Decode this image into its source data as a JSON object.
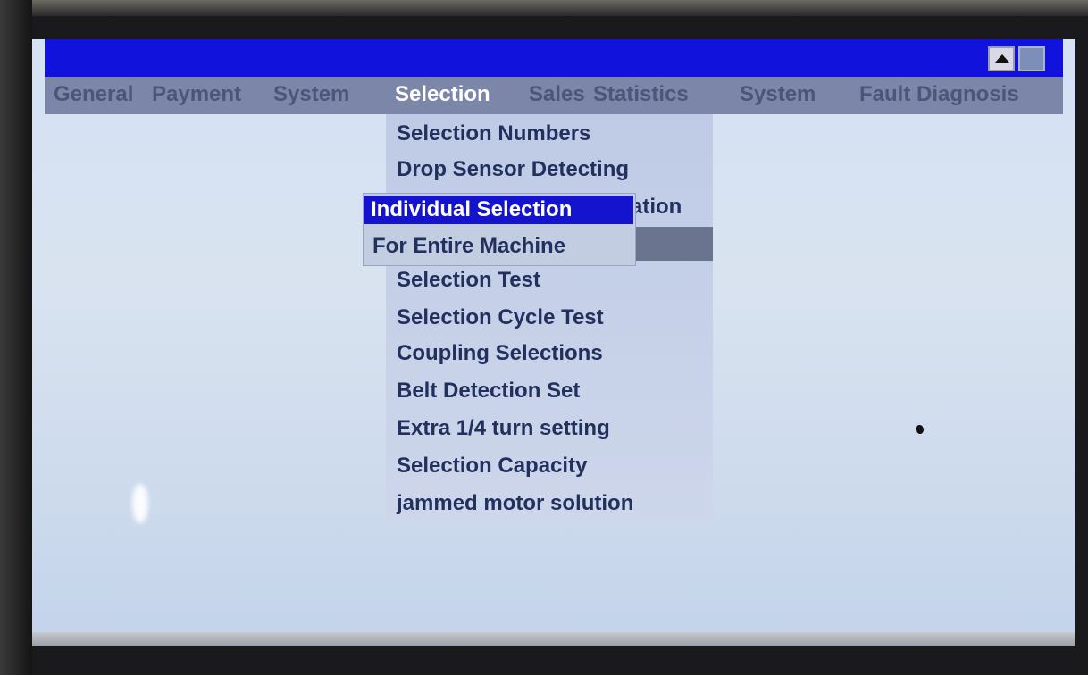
{
  "menubar": {
    "items": [
      "General",
      "Payment",
      "System",
      "Selection",
      "Sales",
      "Statistics",
      "System",
      "Fault Diagnosis"
    ],
    "active_index": 3
  },
  "titlebar": {
    "icons": [
      "arrow-up-icon",
      "square-icon"
    ]
  },
  "selection_menu": {
    "items": [
      "Selection Numbers",
      "Drop Sensor Detecting",
      "ation",
      "Selection Test",
      "Selection Cycle Test",
      "Coupling Selections",
      "Belt Detection Set",
      "Extra 1/4 turn setting",
      "Selection Capacity",
      "jammed motor solution"
    ]
  },
  "submenu": {
    "items": [
      "Individual Selection",
      "For Entire Machine"
    ],
    "highlighted_index": 0
  },
  "colors": {
    "titlebar": "#1212dd",
    "menubar": "#7b86a8",
    "highlight": "#1414cf",
    "screen_bg": "#d4e2f4"
  }
}
